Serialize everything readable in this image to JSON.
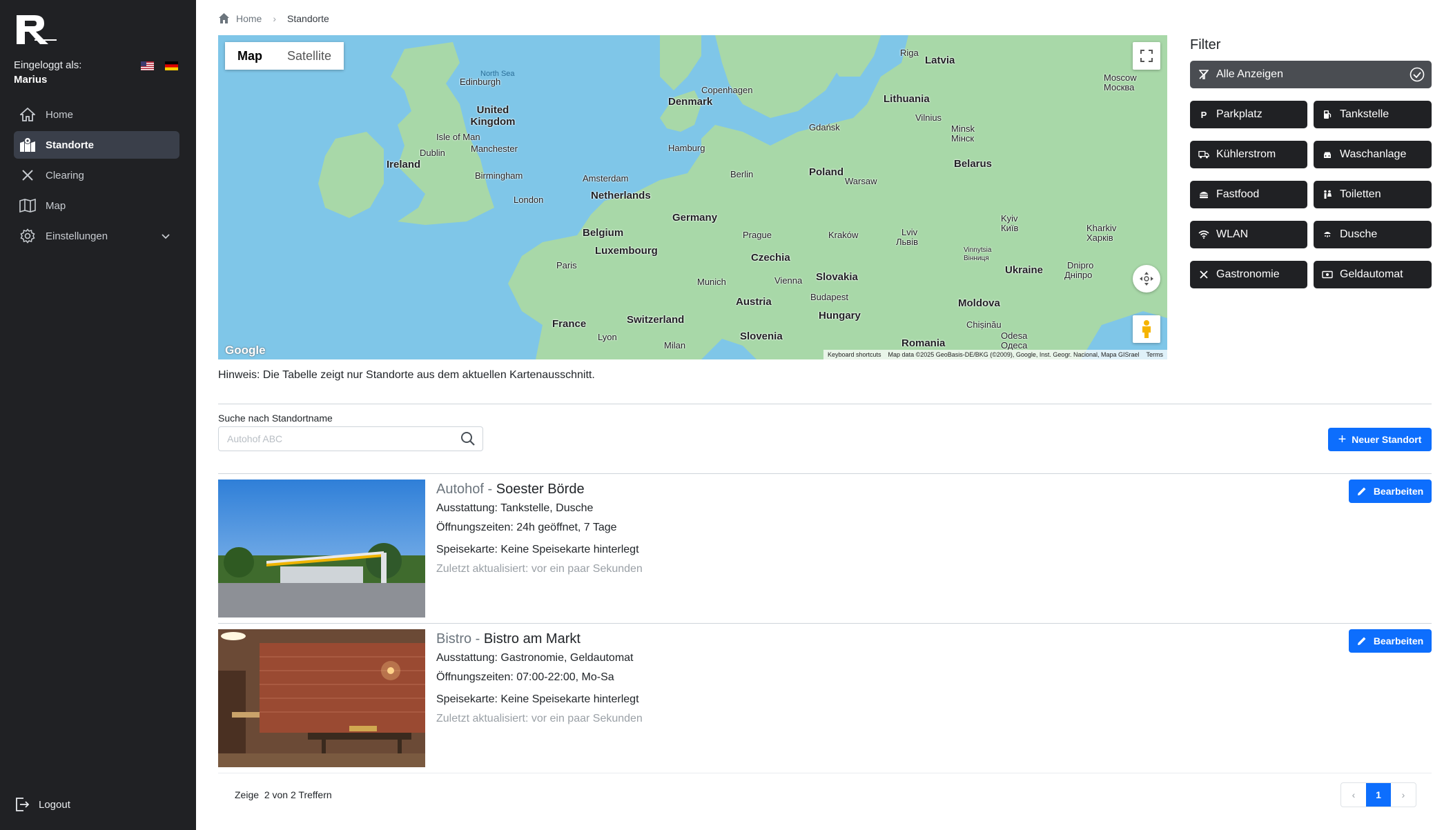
{
  "sidebar": {
    "logged_in_label": "Eingeloggt als:",
    "user_name": "Marius",
    "items": [
      {
        "label": "Home",
        "icon": "home-icon"
      },
      {
        "label": "Standorte",
        "icon": "map-pin-icon"
      },
      {
        "label": "Clearing",
        "icon": "close-icon"
      },
      {
        "label": "Map",
        "icon": "map-icon"
      },
      {
        "label": "Einstellungen",
        "icon": "gear-icon"
      }
    ],
    "logout_label": "Logout"
  },
  "breadcrumb": {
    "home": "Home",
    "current": "Standorte"
  },
  "map": {
    "type_map": "Map",
    "type_satellite": "Satellite",
    "attribution": {
      "shortcuts": "Keyboard shortcuts",
      "data": "Map data ©2025 GeoBasis-DE/BKG (©2009), Google, Inst. Geogr. Nacional, Mapa GISrael",
      "terms": "Terms"
    },
    "google_logo": "Google",
    "labels": {
      "north_sea": "North Sea",
      "riga": "Riga",
      "latvia": "Latvia",
      "moscow": "Moscow",
      "moscow_ru": "Москва",
      "lithuania": "Lithuania",
      "vilnius": "Vilnius",
      "minsk": "Minsk",
      "minsk_ru": "Мінск",
      "belarus": "Belarus",
      "edinburgh": "Edinburgh",
      "united_kingdom": "United Kingdom",
      "isle_of_man": "Isle of Man",
      "dublin": "Dublin",
      "manchester": "Manchester",
      "ireland": "Ireland",
      "birmingham": "Birmingham",
      "london": "London",
      "copenhagen": "Copenhagen",
      "denmark": "Denmark",
      "hamburg": "Hamburg",
      "gdansk": "Gdańsk",
      "amsterdam": "Amsterdam",
      "netherlands": "Netherlands",
      "berlin": "Berlin",
      "poland": "Poland",
      "warsaw": "Warsaw",
      "germany": "Germany",
      "belgium": "Belgium",
      "luxembourg": "Luxembourg",
      "prague": "Prague",
      "krakow": "Kraków",
      "lviv": "Lviv",
      "lviv_ua": "Львів",
      "kyiv": "Kyiv",
      "kyiv_ua": "Київ",
      "kharkiv": "Kharkiv",
      "kharkiv_ua": "Харків",
      "paris": "Paris",
      "czechia": "Czechia",
      "vinnytsia": "Vinnytsia",
      "vinnytsia_ua": "Вінниця",
      "munich": "Munich",
      "vienna": "Vienna",
      "slovakia": "Slovakia",
      "ukraine": "Ukraine",
      "dnipro": "Dnipro",
      "dnipro_ua": "Дніпро",
      "austria": "Austria",
      "budapest": "Budapest",
      "moldova": "Moldova",
      "france": "France",
      "switzerland": "Switzerland",
      "hungary": "Hungary",
      "chisinau": "Chișinău",
      "odesa": "Odesa",
      "odesa_ua": "Одеса",
      "lyon": "Lyon",
      "milan": "Milan",
      "slovenia": "Slovenia",
      "romania": "Romania"
    }
  },
  "filter": {
    "title": "Filter",
    "all": "Alle Anzeigen",
    "options": [
      "Parkplatz",
      "Tankstelle",
      "Kühlerstrom",
      "Waschanlage",
      "Fastfood",
      "Toiletten",
      "WLAN",
      "Dusche",
      "Gastronomie",
      "Geldautomat"
    ]
  },
  "hint": "Hinweis: Die Tabelle zeigt nur Standorte aus dem aktuellen Kartenausschnitt.",
  "search": {
    "label": "Suche nach Standortname",
    "placeholder": "Autohof ABC",
    "value": ""
  },
  "new_button": "Neuer Standort",
  "locations": [
    {
      "category": "Autohof",
      "separator": " - ",
      "name": "Soester Börde",
      "equipment": "Ausstattung: Tankstelle, Dusche",
      "hours": "Öffnungszeiten: 24h geöffnet, 7 Tage",
      "menu": "Speisekarte: Keine Speisekarte hinterlegt",
      "updated": "Zuletzt aktualisiert: vor ein paar Sekunden",
      "edit": "Bearbeiten"
    },
    {
      "category": "Bistro",
      "separator": " - ",
      "name": "Bistro am Markt",
      "equipment": "Ausstattung: Gastronomie, Geldautomat",
      "hours": "Öffnungszeiten: 07:00-22:00, Mo-Sa",
      "menu": "Speisekarte: Keine Speisekarte hinterlegt",
      "updated": "Zuletzt aktualisiert: vor ein paar Sekunden",
      "edit": "Bearbeiten"
    }
  ],
  "pagination": {
    "prefix": "Zeige",
    "shown": "2",
    "of": "von",
    "total": "2",
    "suffix": "Treffern",
    "current_page": "1",
    "prev": "‹",
    "next": "›"
  },
  "colors": {
    "sidebar_bg": "#202124",
    "primary": "#0d6efd",
    "filter_bg": "#202124",
    "map_water": "#7fc6e8",
    "map_land": "#a8d8a8"
  }
}
